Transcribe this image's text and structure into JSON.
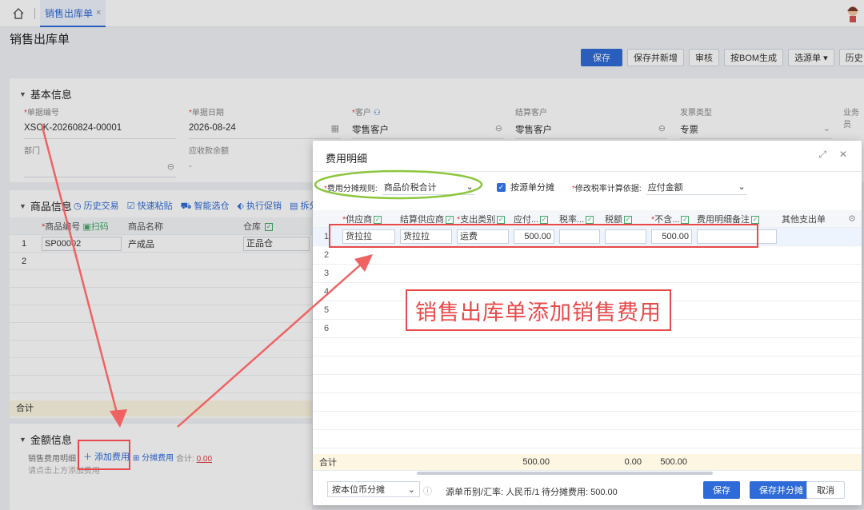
{
  "topbar": {
    "tab_label": "销售出库单",
    "tab_close": "×"
  },
  "page": {
    "title": "销售出库单"
  },
  "toolbar": [
    "保存",
    "保存并新增",
    "审核",
    "按BOM生成",
    "选源单 ▾",
    "历史"
  ],
  "basic": {
    "section_title": "基本信息",
    "fields": [
      {
        "label": "单据编号",
        "value": "XSCK-20260824-00001"
      },
      {
        "label": "单据日期",
        "value": "2026-08-24"
      },
      {
        "label": "客户",
        "value": "零售客户"
      },
      {
        "label": "结算客户",
        "value": "零售客户"
      },
      {
        "label": "发票类型",
        "value": "专票"
      },
      {
        "label": "业务员",
        "value": ""
      },
      {
        "label": "部门",
        "value": ""
      },
      {
        "label": "应收款余额",
        "value": "-"
      }
    ]
  },
  "goods": {
    "section_title": "商品信息",
    "tools": [
      "历史交易",
      "快速粘贴",
      "智能选仓",
      "执行促销",
      "拆分"
    ],
    "headers": [
      "",
      "商品编号",
      "扫码",
      "商品名称",
      "仓库"
    ],
    "rows": [
      {
        "no": "1",
        "code": "SP00002",
        "name": "产成品",
        "warehouse": "正品仓"
      },
      {
        "no": "2",
        "code": "",
        "name": "",
        "warehouse": ""
      }
    ],
    "sum_label": "合计"
  },
  "amount": {
    "section_title": "金额信息",
    "fee_label": "销售费用明细",
    "add_fee": "添加费用",
    "split_fee": "分摊费用",
    "total_label": "合计:",
    "total_value": "0.00",
    "hint": "请点击上方添加费用"
  },
  "modal": {
    "title": "费用明细",
    "rule_label": "费用分摊规则:",
    "rule_value": "商品价税合计",
    "by_source_label": "按源单分摊",
    "tax_basis_label": "修改税率计算依据:",
    "tax_basis_value": "应付金额",
    "headers": [
      "",
      "供应商",
      "结算供应商",
      "支出类别",
      "应付...",
      "税率...",
      "税额",
      "不含...",
      "费用明细备注",
      "其他支出单"
    ],
    "rows": [
      {
        "no": "1",
        "supplier": "货拉拉",
        "settle": "货拉拉",
        "category": "运费",
        "payable": "500.00",
        "rate": "",
        "tax": "",
        "excl": "500.00",
        "note": ""
      },
      {
        "no": "2"
      },
      {
        "no": "3"
      },
      {
        "no": "4"
      },
      {
        "no": "5"
      },
      {
        "no": "6"
      }
    ],
    "sum_label": "合计",
    "sum_payable": "500.00",
    "sum_tax": "0.00",
    "sum_excl": "500.00",
    "split_mode": "按本位币分摊",
    "currency_label": "源单币别/汇率:",
    "currency_value": "人民币/1",
    "pending_label": "待分摊费用:",
    "pending_value": "500.00",
    "save": "保存",
    "save_split": "保存并分摊",
    "cancel": "取消"
  },
  "annotation": "销售出库单添加销售费用",
  "colors": {
    "accent": "#2f6bd8",
    "annotation": "#e84a4a",
    "highlight": "#8dc63f"
  }
}
